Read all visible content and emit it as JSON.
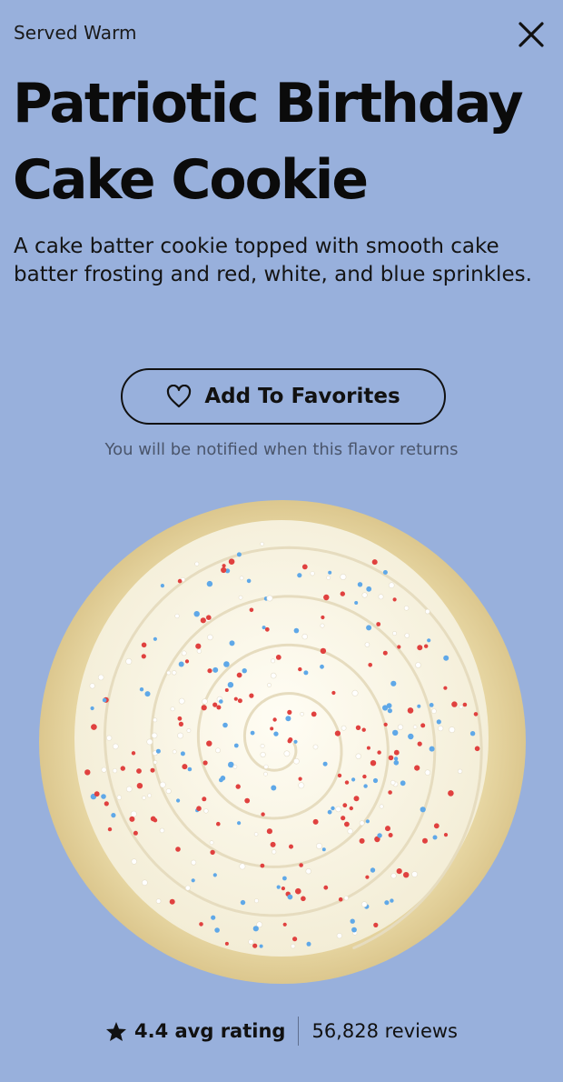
{
  "header": {
    "served_label": "Served Warm",
    "close_icon": "close-icon"
  },
  "product": {
    "title_line1": "Patriotic Birthday",
    "title_line2": "Cake Cookie",
    "description": "A cake batter cookie topped with smooth cake batter frosting and red, white, and blue sprinkles."
  },
  "favorites": {
    "button_label": "Add To Favorites",
    "icon": "heart-icon",
    "notify_text": "You will be notified when this flavor returns"
  },
  "rating": {
    "icon": "star-icon",
    "avg_text": "4.4 avg rating",
    "reviews_text": "56,828 reviews"
  },
  "colors": {
    "background": "#98B0DC",
    "sprinkle_red": "#E0413F",
    "sprinkle_blue": "#5FA8E8",
    "frosting": "#FBF8EC",
    "cookie": "#EBDDAE"
  }
}
